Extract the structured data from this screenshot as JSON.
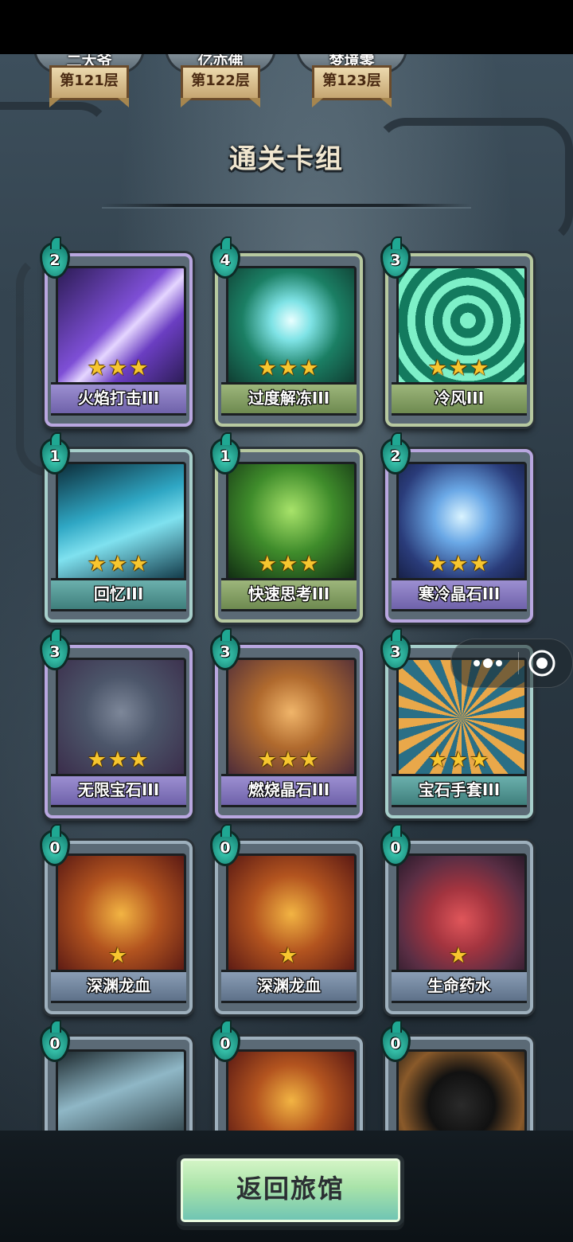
{
  "floors": [
    {
      "player": "二大爷",
      "floor": "第121层"
    },
    {
      "player": "亿亦佛",
      "floor": "第122层"
    },
    {
      "player": "梦境零",
      "floor": "第123层"
    }
  ],
  "section_title": "通关卡组",
  "cards": [
    {
      "cost": "2",
      "name": "火焰打击III",
      "stars": "★★★",
      "rarity": "purple"
    },
    {
      "cost": "4",
      "name": "过度解冻III",
      "stars": "★★★",
      "rarity": "green"
    },
    {
      "cost": "3",
      "name": "冷风III",
      "stars": "★★★",
      "rarity": "green"
    },
    {
      "cost": "1",
      "name": "回忆III",
      "stars": "★★★",
      "rarity": "teal"
    },
    {
      "cost": "1",
      "name": "快速思考III",
      "stars": "★★★",
      "rarity": "green"
    },
    {
      "cost": "2",
      "name": "寒冷晶石III",
      "stars": "★★★",
      "rarity": "purple"
    },
    {
      "cost": "3",
      "name": "无限宝石III",
      "stars": "★★★",
      "rarity": "purple"
    },
    {
      "cost": "3",
      "name": "燃烧晶石III",
      "stars": "★★★",
      "rarity": "purple"
    },
    {
      "cost": "3",
      "name": "宝石手套III",
      "stars": "★★★",
      "rarity": "teal"
    },
    {
      "cost": "0",
      "name": "深渊龙血",
      "stars": "★",
      "rarity": "gray"
    },
    {
      "cost": "0",
      "name": "深渊龙血",
      "stars": "★",
      "rarity": "gray"
    },
    {
      "cost": "0",
      "name": "生命药水",
      "stars": "★",
      "rarity": "gray"
    },
    {
      "cost": "0",
      "name": "",
      "stars": "",
      "rarity": "gray"
    },
    {
      "cost": "0",
      "name": "",
      "stars": "",
      "rarity": "gray"
    },
    {
      "cost": "0",
      "name": "",
      "stars": "",
      "rarity": "gray"
    }
  ],
  "return_button": "返回旅馆",
  "icons": {
    "menu": "more-dots-icon",
    "close": "target-icon"
  },
  "colors": {
    "accent": "#a9e3a9",
    "star": "#f7c62f",
    "cost_gem": "#3fd1b8"
  }
}
